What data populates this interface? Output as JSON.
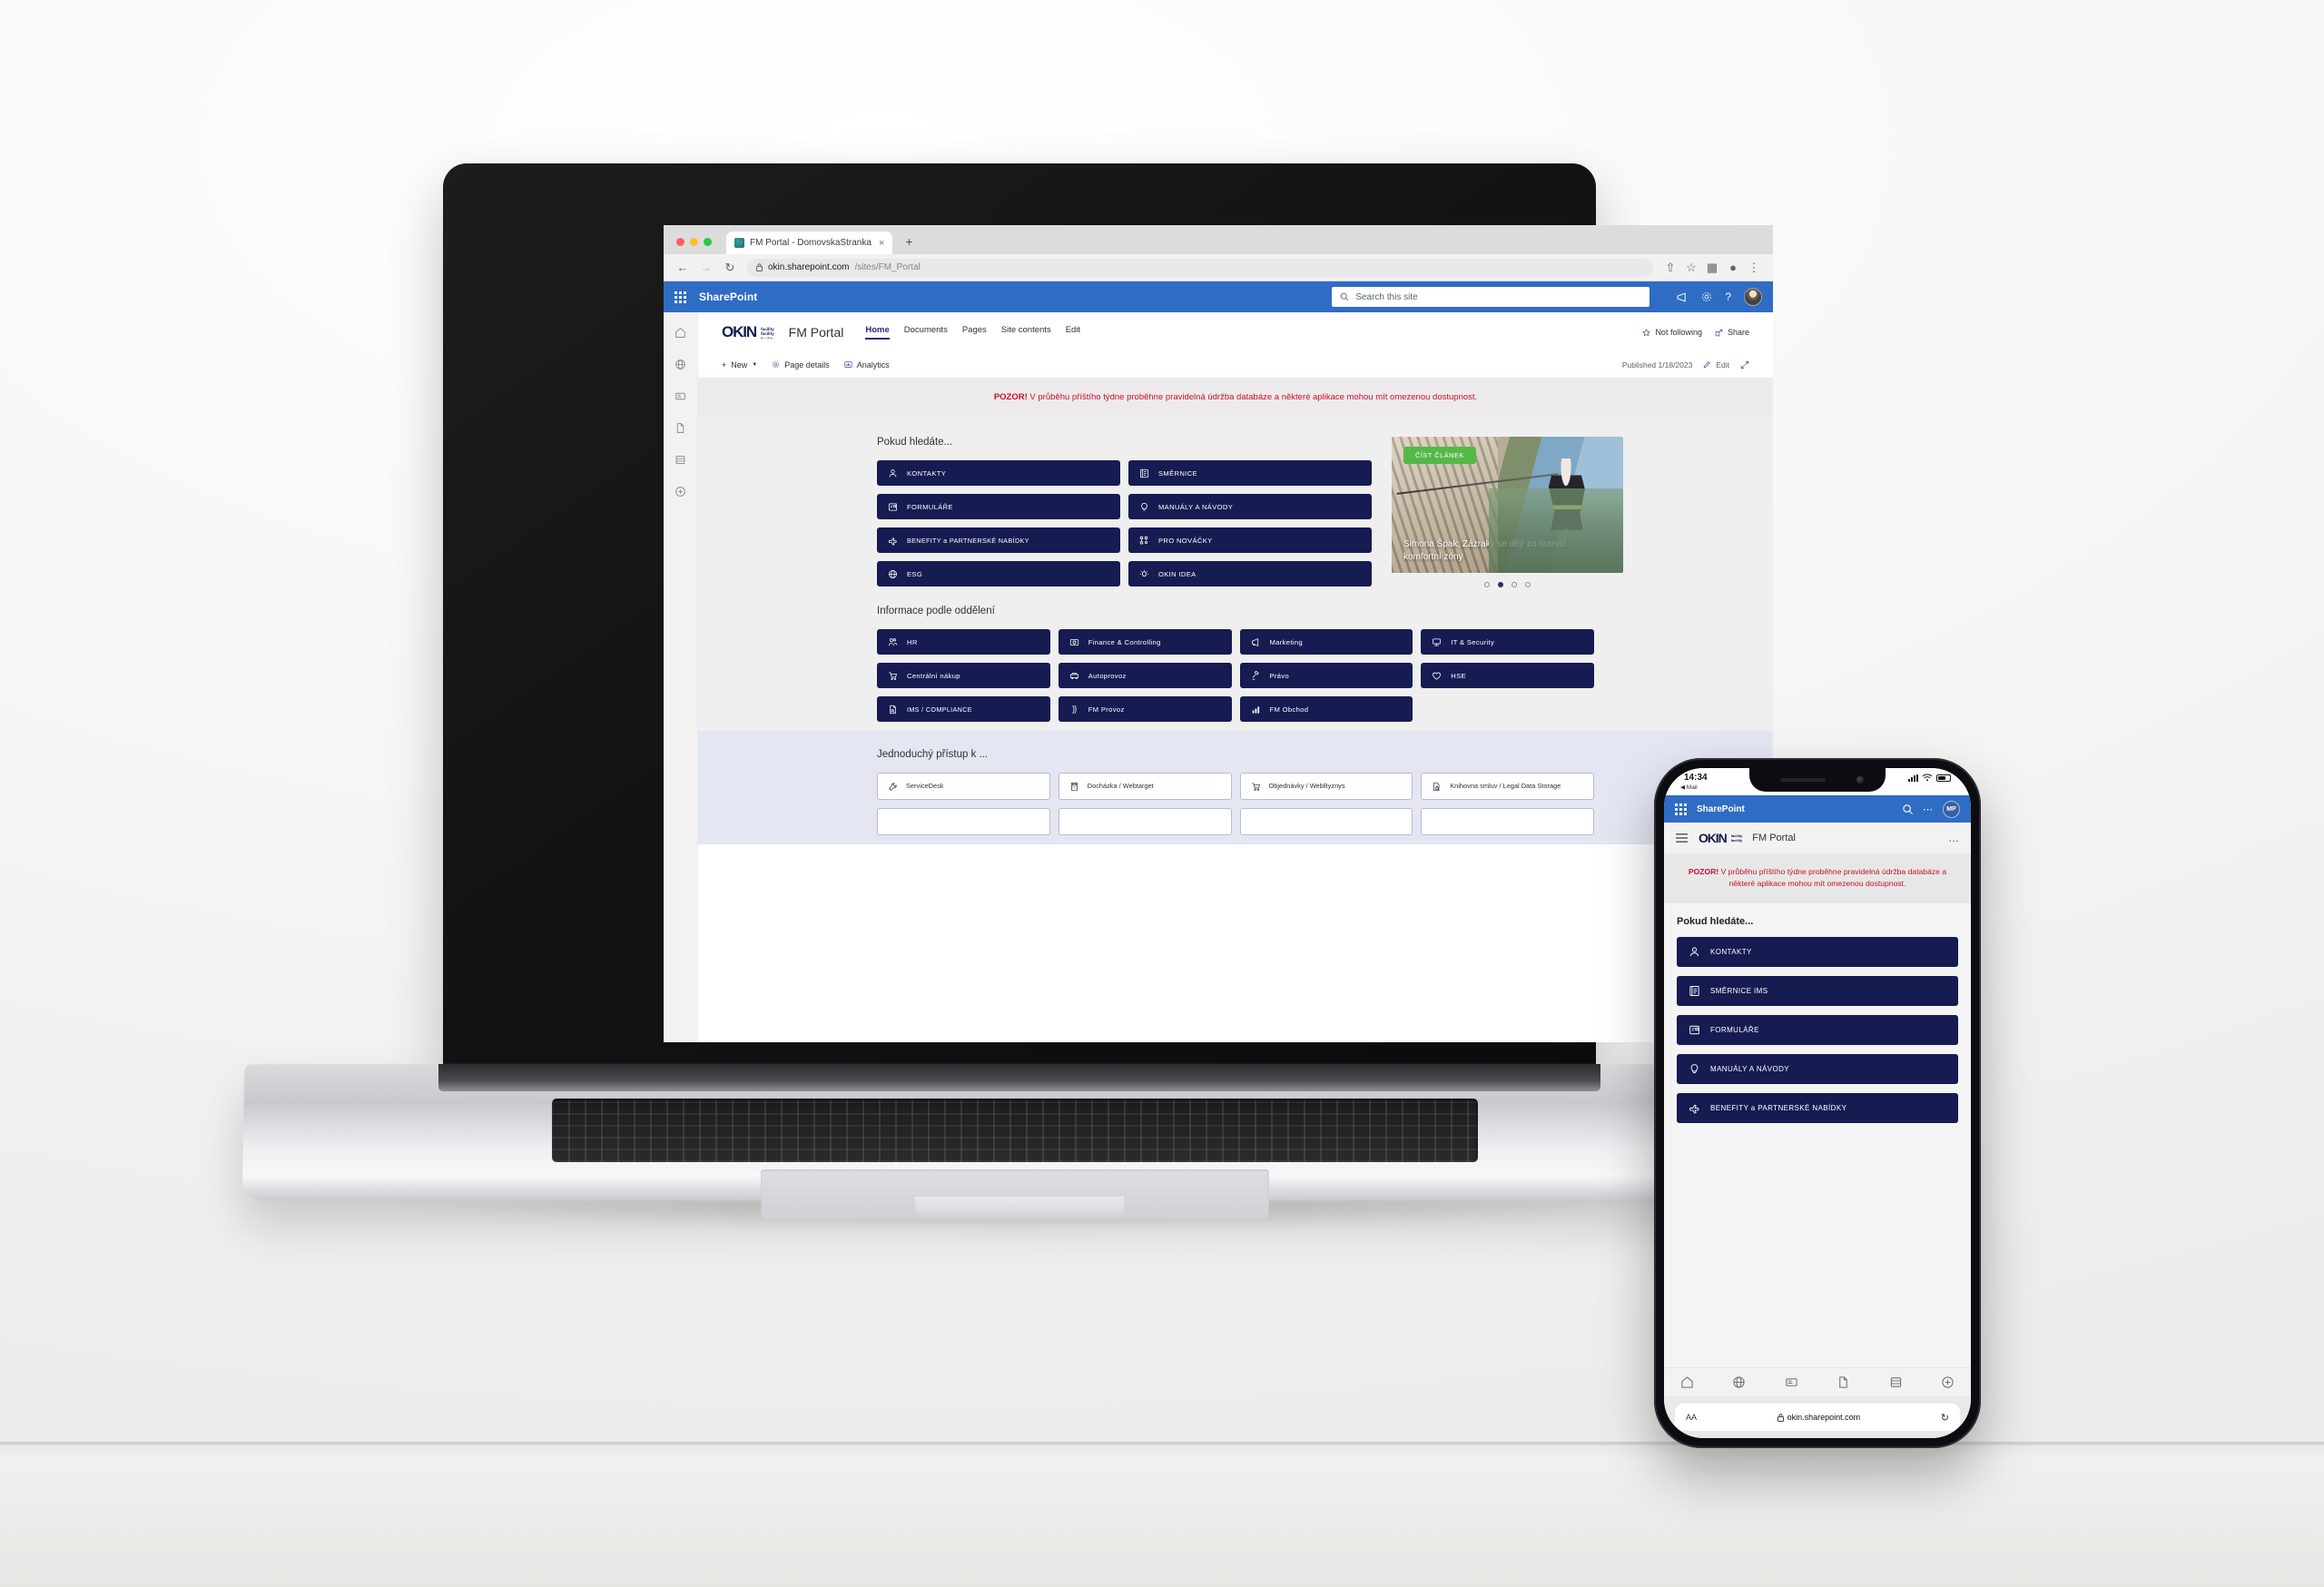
{
  "browser": {
    "tab_title": "FM Portal - DomovskaStranka",
    "tab_close": "×",
    "new_tab": "+",
    "back": "←",
    "forward": "→",
    "reload": "↻",
    "lock": "ὑ2",
    "url_host": "okin.sharepoint.com",
    "url_path": "/sites/FM_Portal"
  },
  "suitebar": {
    "brand": "SharePoint",
    "search_placeholder": "Search this site",
    "icons": [
      "megaphone-icon",
      "gear-icon",
      "help-icon",
      "avatar"
    ],
    "help_label": "?"
  },
  "site": {
    "logo_word": "OKIN",
    "logo_sub_lines": [
      "facility",
      "facility",
      "facility"
    ],
    "title": "FM Portal",
    "nav": [
      {
        "label": "Home",
        "active": true
      },
      {
        "label": "Documents",
        "active": false
      },
      {
        "label": "Pages",
        "active": false
      },
      {
        "label": "Site contents",
        "active": false
      },
      {
        "label": "Edit",
        "active": false
      }
    ],
    "follow_label": "Not following",
    "share_label": "Share"
  },
  "command_bar": {
    "new_label": "New",
    "page_details_label": "Page details",
    "analytics_label": "Analytics",
    "published_label": "Published 1/18/2023",
    "edit_label": "Edit",
    "expand_icon": "expand-icon"
  },
  "alert": {
    "bold": "POZOR!",
    "text": " V průběhu příštího týdne proběhne pravidelná údržba databáze a některé aplikace mohou mít omezenou dostupnost.",
    "color": "#c8102e"
  },
  "section_search": {
    "title": "Pokud hledáte...",
    "tiles": [
      {
        "label": "KONTAKTY",
        "icon": "person-icon"
      },
      {
        "label": "SMĚRNICE",
        "icon": "list-card-icon"
      },
      {
        "label": "FORMULÁŘE",
        "icon": "form-icon"
      },
      {
        "label": "MANUÁLY A NÁVODY",
        "icon": "lightbulb-icon"
      },
      {
        "label": "BENEFITY a PARTNERSKÉ NABÍDKY",
        "icon": "plane-icon"
      },
      {
        "label": "PRO NOVÁČKY",
        "icon": "sitemap-icon"
      },
      {
        "label": "ESG",
        "icon": "globe-icon"
      },
      {
        "label": "OKIN IDEA",
        "icon": "idea-icon"
      }
    ]
  },
  "hero": {
    "cta_label": "ČÍST ČLÁNEK",
    "cta_color": "#54b848",
    "title": "Simona Špak: Zázraky se dějí za hranicí komfortní zóny",
    "dots": 4,
    "active_dot": 2
  },
  "section_departments": {
    "title": "Informace podle oddělení",
    "tiles": [
      {
        "label": "HR",
        "icon": "people-icon"
      },
      {
        "label": "Finance & Controlling",
        "icon": "money-icon"
      },
      {
        "label": "Marketing",
        "icon": "megaphone-icon"
      },
      {
        "label": "IT & Security",
        "icon": "monitor-icon"
      },
      {
        "label": "Centrální nákup",
        "icon": "cart-icon"
      },
      {
        "label": "Autoprovoz",
        "icon": "car-icon"
      },
      {
        "label": "Právo",
        "icon": "gavel-icon"
      },
      {
        "label": "HSE",
        "icon": "heart-icon"
      },
      {
        "label": "IMS / COMPLIANCE",
        "icon": "document-search-icon"
      },
      {
        "label": "FM Provoz",
        "icon": "layers-icon"
      },
      {
        "label": "FM Obchod",
        "icon": "bar-chart-icon"
      }
    ]
  },
  "section_access": {
    "title": "Jednoduchý přístup k ...",
    "tiles": [
      {
        "label": "ServiceDesk",
        "icon": "wrench-icon"
      },
      {
        "label": "Docházka / Webtarget",
        "icon": "calculator-icon"
      },
      {
        "label": "Objednávky / WebByznys",
        "icon": "cart-icon"
      },
      {
        "label": "Knihovna smluv / Legal Data Storage",
        "icon": "file-lock-icon"
      }
    ]
  },
  "left_rail": {
    "items": [
      "home-icon",
      "globe-icon",
      "news-icon",
      "page-icon",
      "list-icon",
      "add-circle-icon"
    ]
  },
  "phone": {
    "status": {
      "time": "14:34",
      "back_app": "◀ Mail"
    },
    "suitebar": {
      "brand": "SharePoint",
      "search_icon": "search-icon",
      "more_icon": "more-icon",
      "avatar_initials": "MP"
    },
    "site_header": {
      "menu_icon": "hamburger-icon",
      "logo_word": "OKIN",
      "title": "FM Portal",
      "more": "…"
    },
    "alert": {
      "bold": "POZOR!",
      "text": " V průběhu příštího týdne proběhne pravidelná údržba databáze a některé aplikace mohou mít omezenou dostupnost."
    },
    "section_title": "Pokud hledáte...",
    "tiles": [
      {
        "label": "KONTAKTY",
        "icon": "person-icon"
      },
      {
        "label": "SMĚRNICE IMS",
        "icon": "list-card-icon"
      },
      {
        "label": "FORMULÁŘE",
        "icon": "form-icon"
      },
      {
        "label": "MANUÁLY A NÁVODY",
        "icon": "lightbulb-icon"
      },
      {
        "label": "BENEFITY a PARTNERSKÉ NABÍDKY",
        "icon": "plane-icon"
      }
    ],
    "appbar": [
      "home-icon",
      "globe-icon",
      "news-icon",
      "page-icon",
      "list-icon",
      "add-circle-icon"
    ],
    "safari": {
      "text_size_label": "AA",
      "url": "okin.sharepoint.com",
      "reload_icon": "↻"
    }
  },
  "colors": {
    "tile_navy": "#161b52",
    "sharepoint_blue": "#2f6cc4",
    "alert_red": "#c8102e",
    "cta_green": "#54b848"
  }
}
